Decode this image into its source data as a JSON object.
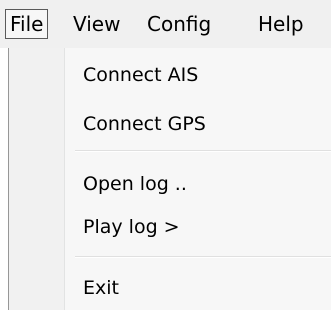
{
  "menubar": {
    "items": [
      {
        "label": "File"
      },
      {
        "label": "View"
      },
      {
        "label": "Config"
      },
      {
        "label": "Help"
      }
    ]
  },
  "file_menu": {
    "items": [
      {
        "label": "Connect AIS"
      },
      {
        "label": "Connect GPS"
      },
      {
        "label": "Open log .."
      },
      {
        "label": "Play log >"
      },
      {
        "label": "Exit"
      }
    ]
  }
}
